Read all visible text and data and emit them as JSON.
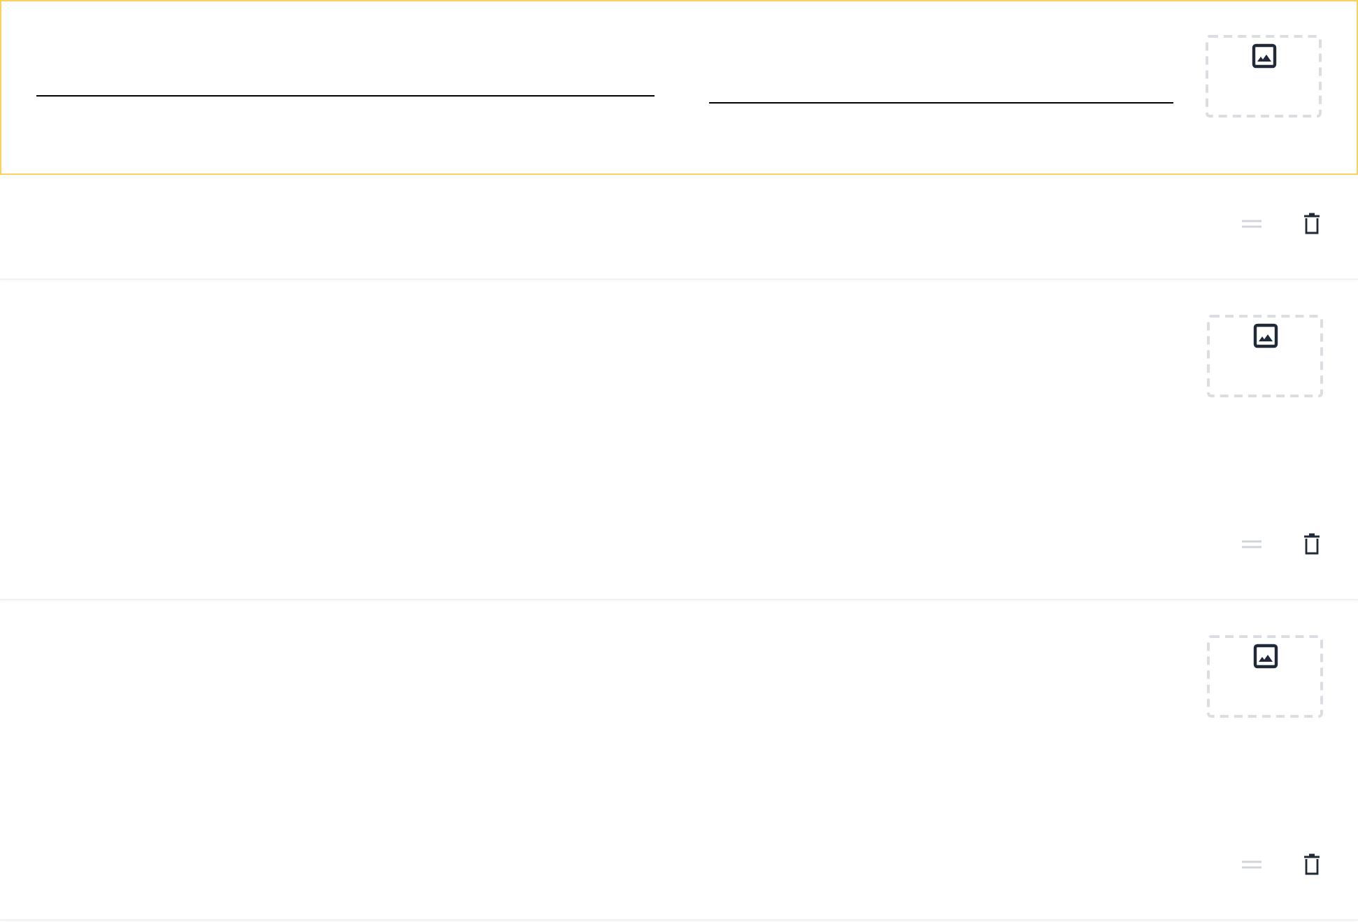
{
  "items": [
    {
      "selected": true
    },
    {
      "selected": false
    },
    {
      "selected": false
    }
  ]
}
